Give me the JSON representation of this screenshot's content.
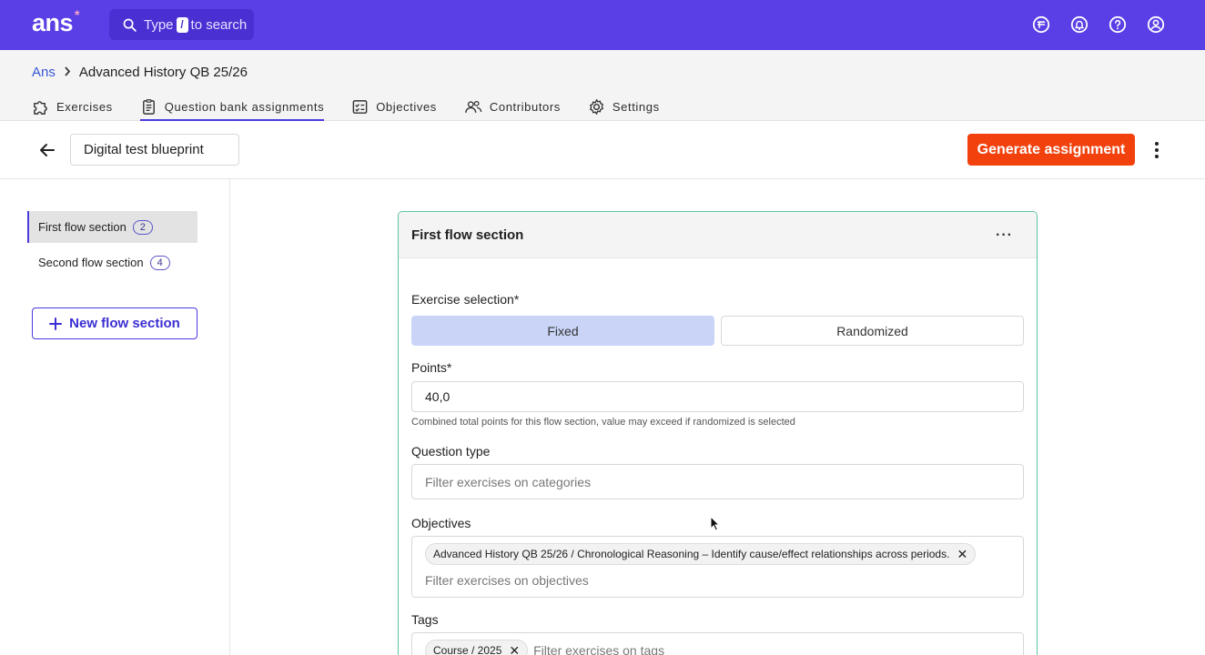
{
  "app": {
    "logo": "ans",
    "logo_mark": "*"
  },
  "search": {
    "prefix": "Type",
    "key": "/",
    "suffix": "to search"
  },
  "top_icons": [
    "currency-icon",
    "notifications-icon",
    "help-icon",
    "account-icon"
  ],
  "breadcrumb": {
    "root": "Ans",
    "current": "Advanced History QB 25/26"
  },
  "tabs": [
    {
      "label": "Exercises",
      "icon": "puzzle-icon"
    },
    {
      "label": "Question bank assignments",
      "icon": "clipboard-icon",
      "active": true
    },
    {
      "label": "Objectives",
      "icon": "checklist-icon"
    },
    {
      "label": "Contributors",
      "icon": "people-icon"
    },
    {
      "label": "Settings",
      "icon": "gear-icon"
    }
  ],
  "toolbar": {
    "title_value": "Digital test blueprint",
    "generate_label": "Generate assignment"
  },
  "sidebar": {
    "sections": [
      {
        "label": "First flow section",
        "count": "2",
        "active": true
      },
      {
        "label": "Second flow section",
        "count": "4"
      }
    ],
    "new_section_label": "New flow section"
  },
  "card": {
    "title": "First flow section",
    "more": "···",
    "exercise_selection": {
      "label": "Exercise selection*",
      "options": [
        "Fixed",
        "Randomized"
      ],
      "selected": "Fixed"
    },
    "points": {
      "label": "Points*",
      "value": "40,0",
      "hint": "Combined total points for this flow section, value may exceed if randomized is selected"
    },
    "question_type": {
      "label": "Question type",
      "placeholder": "Filter exercises on categories"
    },
    "objectives": {
      "label": "Objectives",
      "chip": "Advanced History QB 25/26 / Chronological Reasoning – Identify cause/effect relationships across periods.",
      "placeholder": "Filter exercises on objectives"
    },
    "tags": {
      "label": "Tags",
      "chip": "Course / 2025",
      "placeholder": "Filter exercises on tags"
    }
  },
  "colors": {
    "topbar": "#5a3fe6",
    "accent": "#4a3be0",
    "primary_action": "#f2410d",
    "card_border": "#5cc69e",
    "segment_selected": "#c9d4f7"
  }
}
